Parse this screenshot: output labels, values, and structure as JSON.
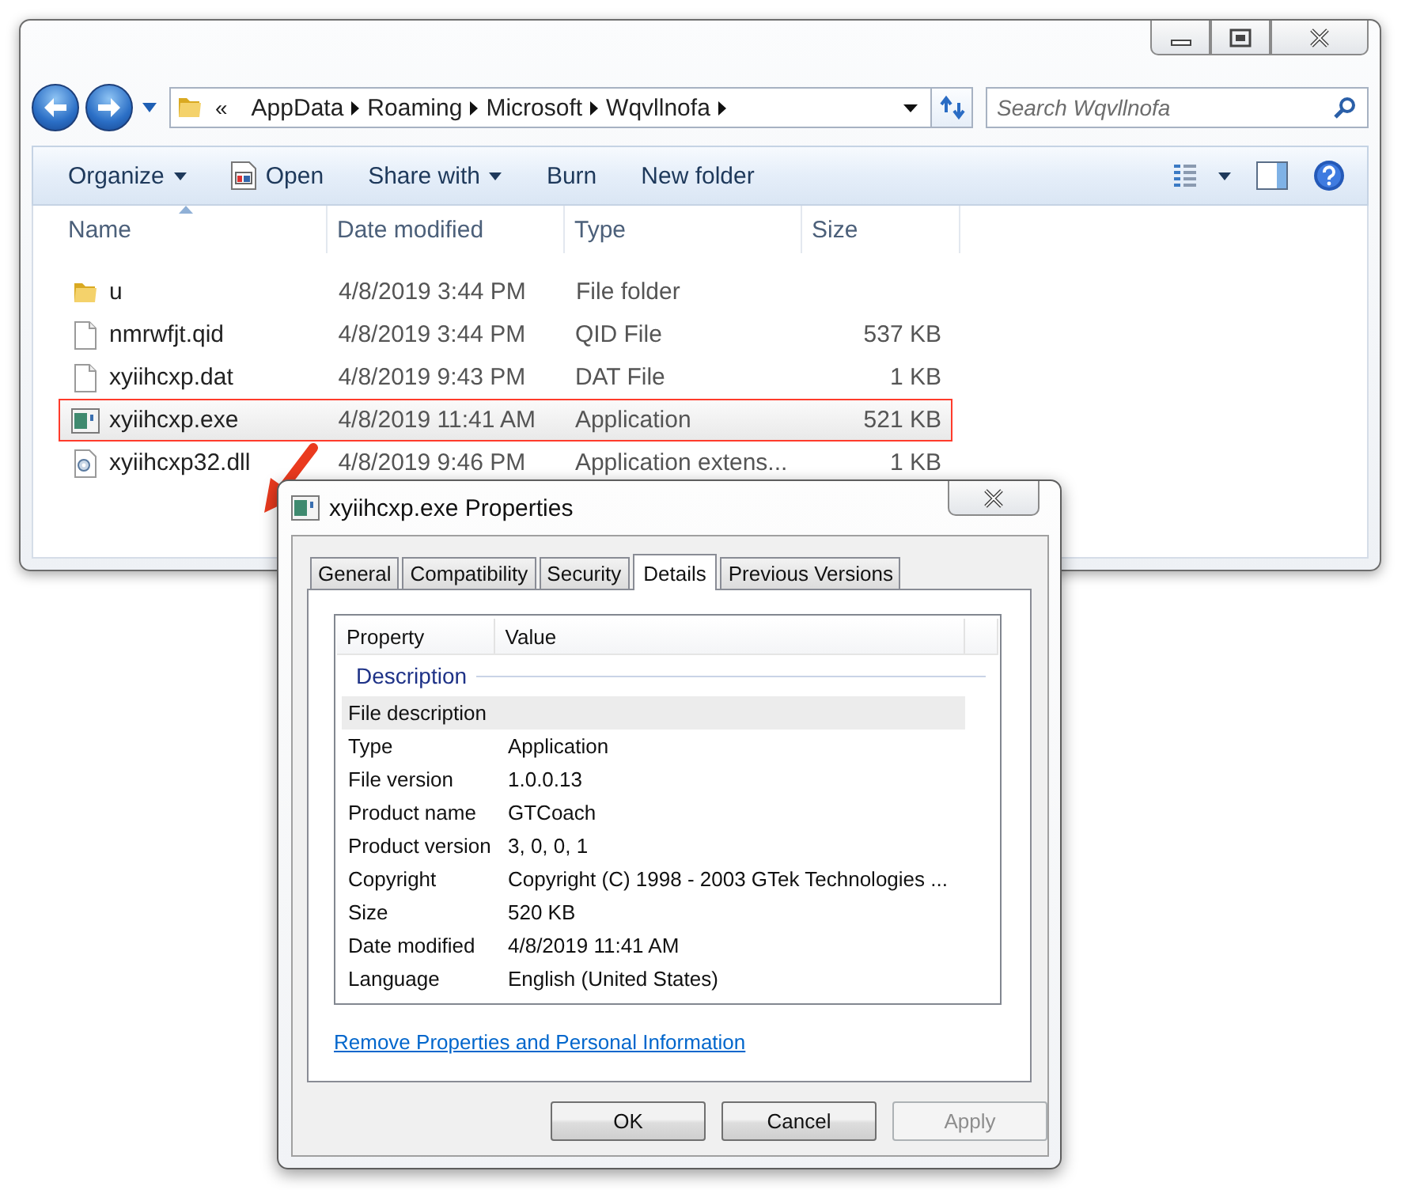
{
  "explorer": {
    "address": {
      "overflow": "«",
      "crumbs": [
        "AppData",
        "Roaming",
        "Microsoft",
        "Wqvllnofa"
      ]
    },
    "search": {
      "placeholder": "Search Wqvllnofa"
    },
    "toolbar": [
      {
        "label": "Organize",
        "kind": "menu"
      },
      {
        "label": "Open",
        "kind": "icon"
      },
      {
        "label": "Share with",
        "kind": "menu"
      },
      {
        "label": "Burn",
        "kind": "plain"
      },
      {
        "label": "New folder",
        "kind": "plain"
      }
    ],
    "columns": [
      {
        "label": "Name",
        "sorted": true
      },
      {
        "label": "Date modified",
        "sorted": false
      },
      {
        "label": "Type",
        "sorted": false
      },
      {
        "label": "Size",
        "sorted": false
      }
    ],
    "rows": [
      {
        "kind": "folder",
        "name": "u",
        "date": "4/8/2019 3:44 PM",
        "type": "File folder",
        "highlighted": false
      },
      {
        "kind": "file",
        "name": "nmrwfjt.qid",
        "date": "4/8/2019 3:44 PM",
        "type": "QID File",
        "size": "537 KB",
        "highlighted": false
      },
      {
        "kind": "file",
        "name": "xyiihcxp.dat",
        "date": "4/8/2019 9:43 PM",
        "type": "DAT File",
        "size": "1 KB",
        "highlighted": false
      },
      {
        "kind": "app",
        "name": "xyiihcxp.exe",
        "date": "4/8/2019 11:41 AM",
        "type": "Application",
        "size": "521 KB",
        "highlighted": true
      },
      {
        "kind": "dll",
        "name": "xyiihcxp32.dll",
        "date": "4/8/2019 9:46 PM",
        "type": "Application extens...",
        "size": "1 KB",
        "highlighted": false
      }
    ]
  },
  "dialog": {
    "title": "xyiihcxp.exe Properties",
    "tabs": [
      {
        "label": "General",
        "selected": false
      },
      {
        "label": "Compatibility",
        "selected": false
      },
      {
        "label": "Security",
        "selected": false
      },
      {
        "label": "Details",
        "selected": true
      },
      {
        "label": "Previous Versions",
        "selected": false
      }
    ],
    "columns": [
      "Property",
      "Value"
    ],
    "group": "Description",
    "properties": [
      {
        "property": "File description",
        "selected": true
      },
      {
        "property": "Type",
        "value": "Application",
        "selected": false
      },
      {
        "property": "File version",
        "value": "1.0.0.13",
        "selected": false
      },
      {
        "property": "Product name",
        "value": "GTCoach",
        "selected": false
      },
      {
        "property": "Product version",
        "value": "3, 0, 0, 1",
        "selected": false
      },
      {
        "property": "Copyright",
        "value": "Copyright (C) 1998 - 2003 GTek Technologies ...",
        "selected": false
      },
      {
        "property": "Size",
        "value": "520 KB",
        "selected": false
      },
      {
        "property": "Date modified",
        "value": "4/8/2019 11:41 AM",
        "selected": false
      },
      {
        "property": "Language",
        "value": "English (United States)",
        "selected": false
      }
    ],
    "link": "Remove Properties and Personal Information",
    "buttons": [
      {
        "label": "OK",
        "disabled": false
      },
      {
        "label": "Cancel",
        "disabled": false
      },
      {
        "label": "Apply",
        "disabled": true
      }
    ]
  }
}
